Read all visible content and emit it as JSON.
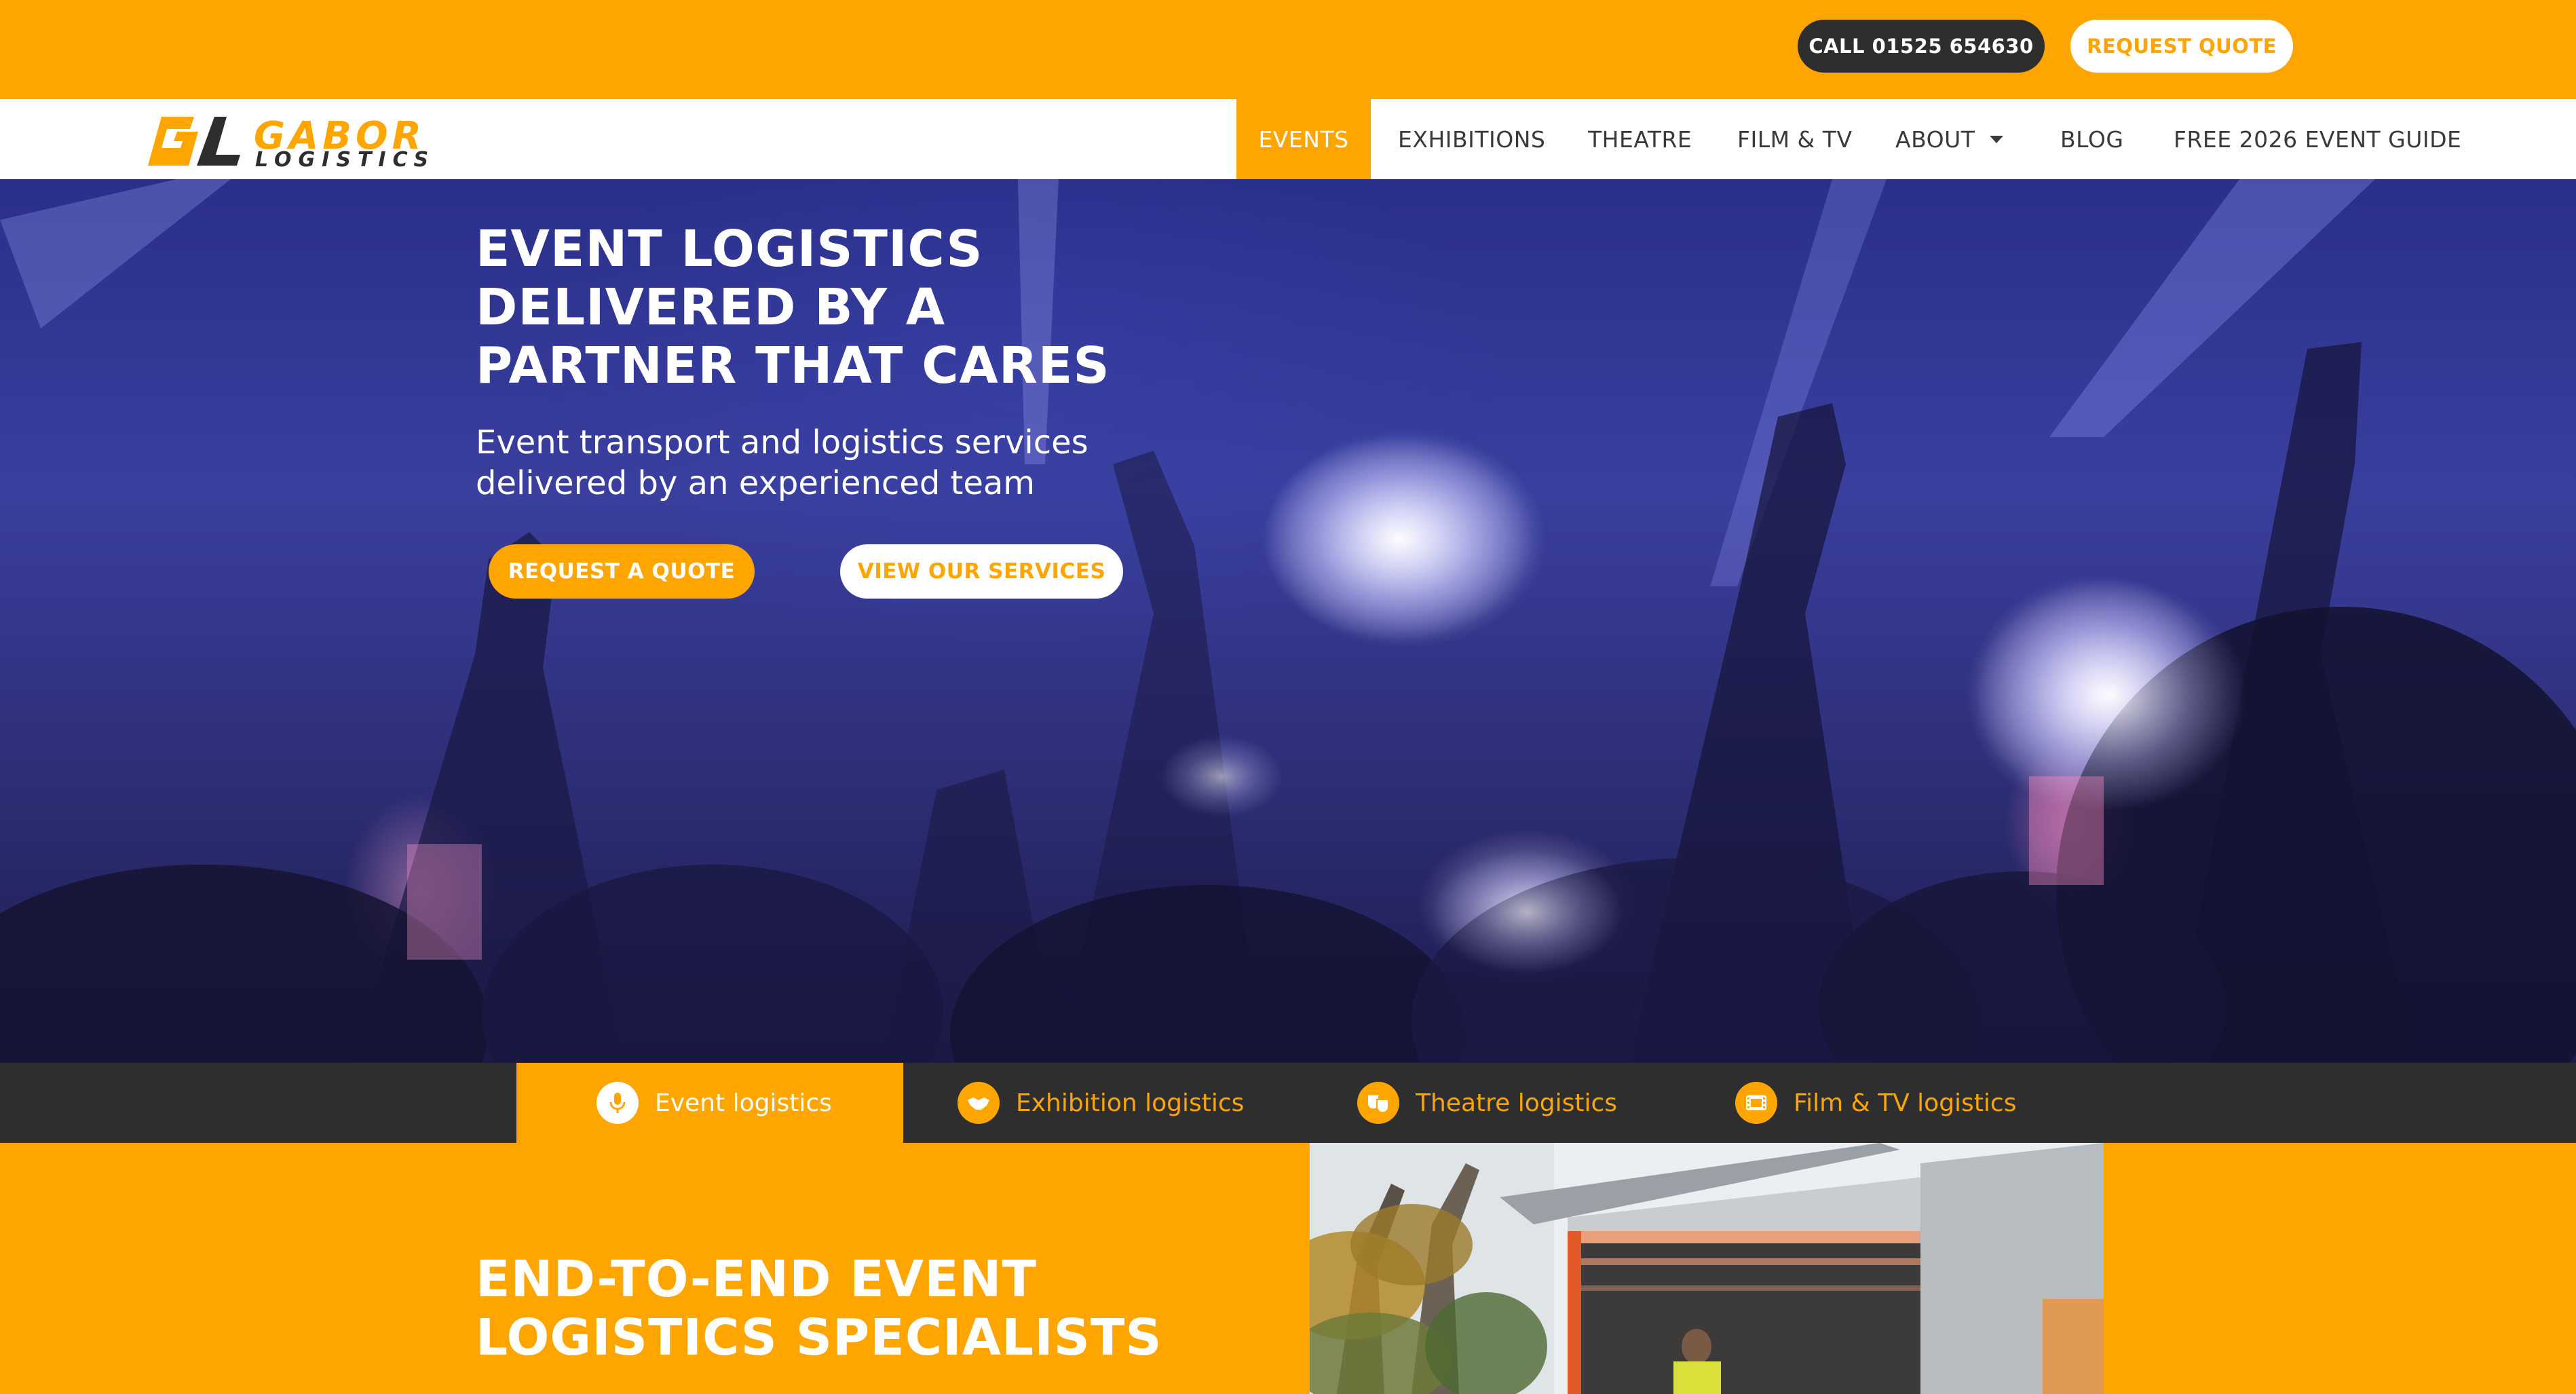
{
  "topbar": {
    "call_label": "CALL 01525 654630",
    "quote_label": "REQUEST QUOTE",
    "accent_color": "#FFA500",
    "dark_color": "#2e2e2e"
  },
  "logo": {
    "line1": "GABOR",
    "line2": "LOGISTICS",
    "mark_text": "GL"
  },
  "nav": {
    "items": [
      {
        "label": "EVENTS",
        "active": true
      },
      {
        "label": "EXHIBITIONS"
      },
      {
        "label": "THEATRE"
      },
      {
        "label": "FILM & TV"
      },
      {
        "label": "ABOUT"
      },
      {
        "label": "BLOG"
      },
      {
        "label": "FREE 2026 EVENT GUIDE"
      }
    ],
    "about_icon": "caret-down-icon"
  },
  "hero": {
    "title": "EVENT LOGISTICS DELIVERED BY A PARTNER THAT CARES",
    "subtitle": "Event transport and logistics services delivered by an experienced team",
    "quote_button": "REQUEST A QUOTE",
    "services_button": "VIEW OUR SERVICES"
  },
  "tabs": [
    {
      "label": "Event logistics",
      "icon": "microphone-icon",
      "active": true
    },
    {
      "label": "Exhibition logistics",
      "icon": "handshake-icon"
    },
    {
      "label": "Theatre logistics",
      "icon": "theatre-masks-icon"
    },
    {
      "label": "Film & TV logistics",
      "icon": "film-icon"
    }
  ],
  "section": {
    "title": "END-TO-END EVENT LOGISTICS SPECIALISTS"
  }
}
